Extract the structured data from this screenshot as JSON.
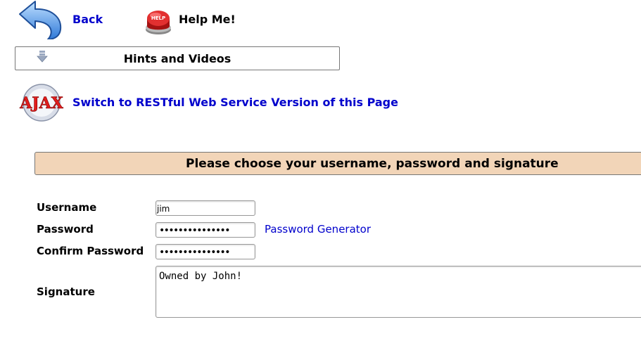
{
  "nav": {
    "back_label": "Back",
    "help_label": "Help Me!",
    "help_button_text": "HELP"
  },
  "hints": {
    "label": "Hints and Videos"
  },
  "ajax": {
    "logo_text": "AJAX",
    "switch_label": "Switch to RESTful Web Service Version of this Page"
  },
  "form": {
    "header": "Please choose your username, password and signature",
    "username_label": "Username",
    "username_value": "jim",
    "password_label": "Password",
    "password_mask": "•••••••••••••••",
    "password_generator_label": "Password Generator",
    "confirm_label": "Confirm Password",
    "confirm_mask": "•••••••••••••••",
    "signature_label": "Signature",
    "signature_value": "Owned by John!"
  },
  "colors": {
    "link": "#0000cc",
    "header_bg": "#f2d5b8"
  }
}
